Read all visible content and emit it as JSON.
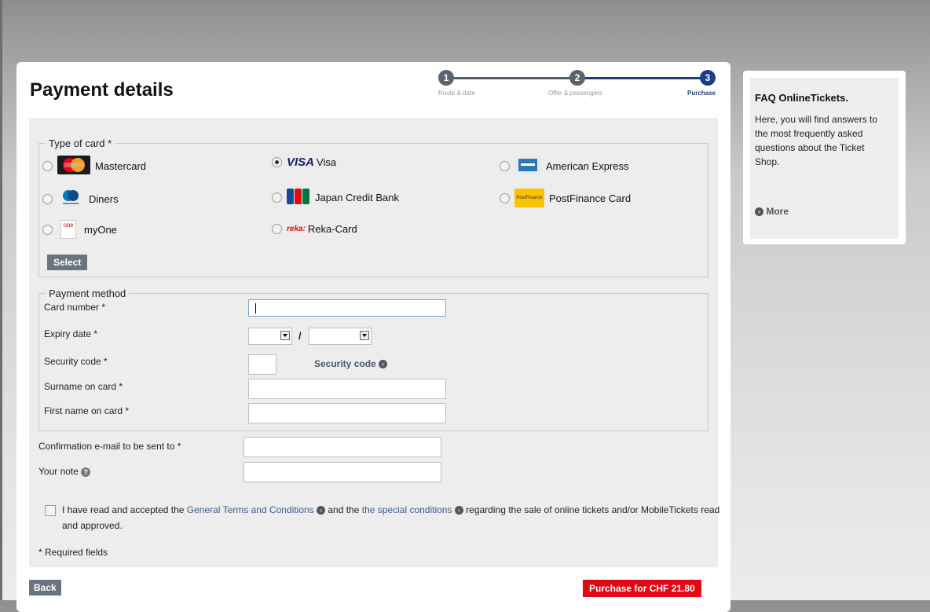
{
  "page": {
    "title": "Payment details"
  },
  "progress": {
    "steps": [
      {
        "number": "1",
        "label": "Route & date"
      },
      {
        "number": "2",
        "label": "Offer & passengers"
      },
      {
        "number": "3",
        "label": "Purchase"
      }
    ]
  },
  "card_type": {
    "legend": "Type of card *",
    "options": [
      {
        "label": "Mastercard",
        "icon": "mastercard-logo",
        "selected": false
      },
      {
        "label": "Visa",
        "icon": "visa-logo",
        "selected": true
      },
      {
        "label": "American Express",
        "icon": "amex-logo",
        "selected": false
      },
      {
        "label": "Diners",
        "icon": "diners-logo",
        "selected": false
      },
      {
        "label": "Japan Credit Bank",
        "icon": "jcb-logo",
        "selected": false
      },
      {
        "label": "PostFinance Card",
        "icon": "postfinance-logo",
        "selected": false
      },
      {
        "label": "myOne",
        "icon": "myone-logo",
        "selected": false
      },
      {
        "label": "Reka-Card",
        "icon": "reka-logo",
        "selected": false
      }
    ],
    "logo_text": {
      "visa": "VISA",
      "reka": "reka:",
      "myone": "one",
      "postfinance": "PostFinance"
    },
    "select_button": "Select"
  },
  "payment_method": {
    "legend": "Payment method",
    "card_number_label": "Card number *",
    "card_number_value": "",
    "expiry_label": "Expiry date *",
    "expiry_month": "",
    "expiry_year": "",
    "expiry_separator": "/",
    "security_label": "Security code *",
    "security_value": "",
    "security_link": "Security code",
    "surname_label": "Surname on card *",
    "surname_value": "",
    "firstname_label": "First name on card *",
    "firstname_value": ""
  },
  "contact": {
    "email_label": "Confirmation e-mail to be sent to *",
    "email_value": "",
    "note_label": "Your note",
    "note_value": ""
  },
  "terms": {
    "checked": false,
    "text_1": "I have read and accepted the ",
    "link_1": "General Terms and Conditions",
    "text_2": " and the ",
    "link_2": "the special conditions",
    "text_3": " regarding the sale of online tickets and/or MobileTickets read and approved."
  },
  "required_note": "* Required fields",
  "buttons": {
    "back": "Back",
    "purchase": "Purchase for CHF 21.80"
  },
  "faq": {
    "title": "FAQ OnlineTickets.",
    "text": "Here, you will find answers to the most frequently asked questions about the Ticket Shop.",
    "more": "More"
  },
  "colors": {
    "accent": "#1c3e86",
    "purchase": "#e30613",
    "button": "#6a7480"
  }
}
